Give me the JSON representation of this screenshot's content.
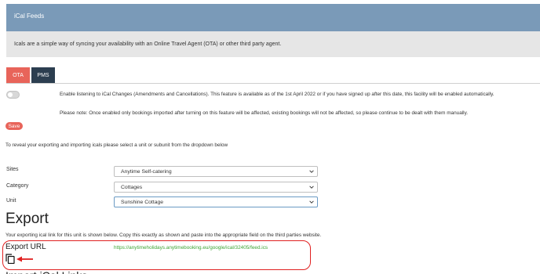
{
  "header": {
    "title": "iCal Feeds",
    "description": "Icals are a simple way of syncing your availability with an Online Travel Agent (OTA) or other third party agent."
  },
  "tabs": [
    {
      "label": "OTA",
      "active": true
    },
    {
      "label": "PMS",
      "active": false
    }
  ],
  "toggle": {
    "enabled": false
  },
  "enable_text": "Enable listening to iCal Changes (Amendments and Cancellations). This feature is available as of the 1st April 2022 or if you have signed up after this date, this facility will be enabled automatically.",
  "note_text": "Please note: Once enabled only bookings imported after turning on this feature will be affected, existing bookings will not be affected, so please continue to be dealt with them manually.",
  "save_label": "Save",
  "reveal_text": "To reveal your exporting and importing icals please select a unit or subunit from the dropdown below",
  "fields": {
    "sites": {
      "label": "Sites",
      "value": "Anytime Self-catering"
    },
    "category": {
      "label": "Category",
      "value": "Cottages"
    },
    "unit": {
      "label": "Unit",
      "value": "Sunshine Cottage"
    }
  },
  "export": {
    "heading": "Export",
    "description": "Your exporting ical link for this unit is shown below. Copy this exactly as shown and paste into the appropriate field on the third parties website.",
    "url_label": "Export URL",
    "url": "https://anytimeholidays.anytimebooking.eu/google/ical/32405/feed.ics"
  },
  "next_heading": "Import iCal Links",
  "colors": {
    "header_bg": "#7a9ab8",
    "accent": "#e8645a",
    "tab_dark": "#2c3e50",
    "link": "#3fa535",
    "highlight": "#e02020"
  },
  "icons": {
    "copy": "copy-icon",
    "arrow": "arrow-left-icon",
    "chevron": "chevron-down-icon"
  }
}
